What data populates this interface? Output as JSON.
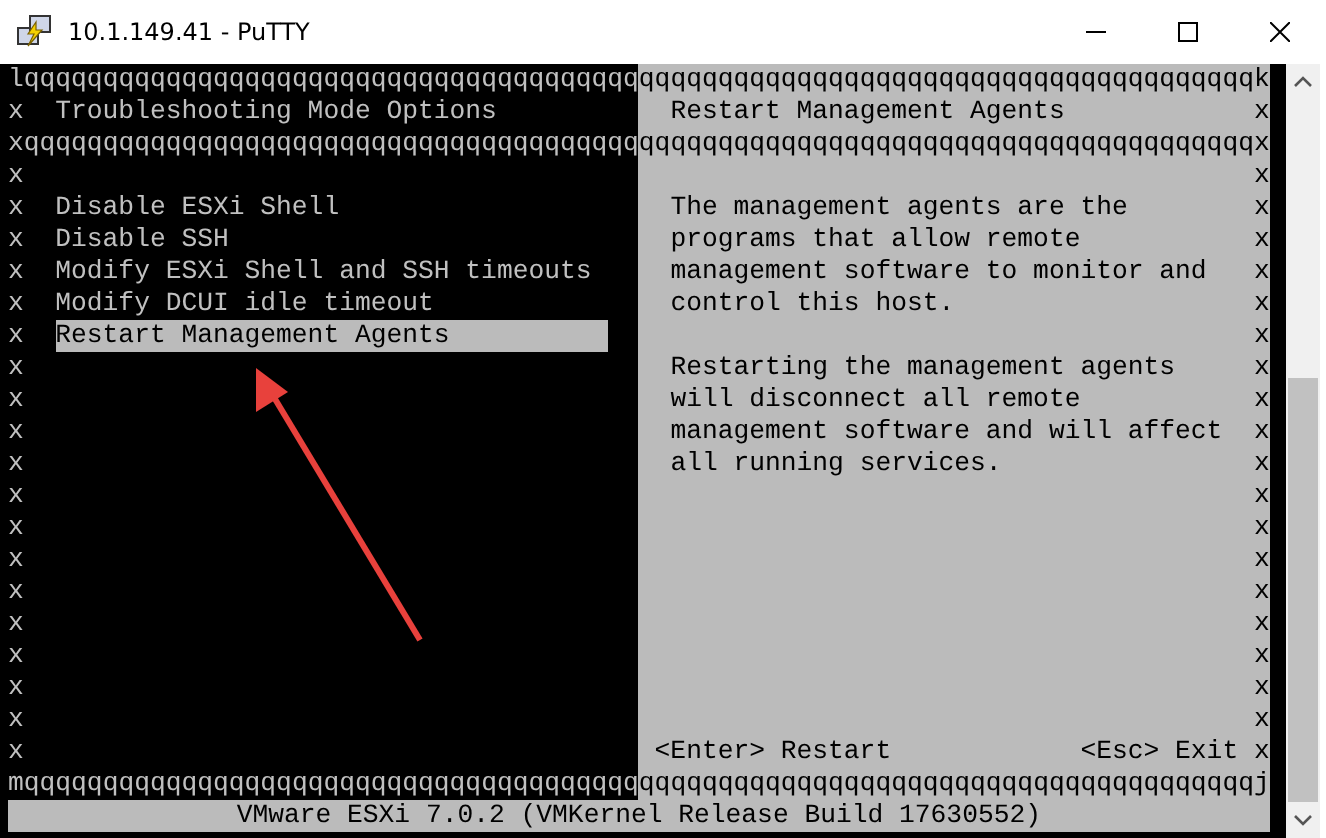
{
  "window": {
    "title": "10.1.149.41 - PuTTY"
  },
  "terminal": {
    "rows": [
      {
        "left": {
          "kind": "border",
          "text": "lqqqqqqqqqqqqqqqqqqqqqqqqqqqqqqqqqqqqqqq"
        },
        "right": {
          "kind": "border",
          "text": "qqqqqqqqqqqqqqqqqqqqqqqqqqqqqqqqqqqqqqqk"
        }
      },
      {
        "left": {
          "kind": "line",
          "edge": "x",
          "text": "Troubleshooting Mode Options"
        },
        "right": {
          "kind": "line",
          "text": "Restart Management Agents",
          "edge": "x"
        }
      },
      {
        "left": {
          "kind": "border",
          "text": "xqqqqqqqqqqqqqqqqqqqqqqqqqqqqqqqqqqqqqqq"
        },
        "right": {
          "kind": "border",
          "text": "qqqqqqqqqqqqqqqqqqqqqqqqqqqqqqqqqqqqqqqx"
        }
      },
      {
        "left": {
          "kind": "line",
          "edge": "x"
        },
        "right": {
          "kind": "line",
          "edge": "x"
        }
      },
      {
        "left": {
          "kind": "item",
          "edge": "x",
          "text": "Disable ESXi Shell",
          "selected": false
        },
        "right": {
          "kind": "line",
          "text": "The management agents are the",
          "edge": "x"
        }
      },
      {
        "left": {
          "kind": "item",
          "edge": "x",
          "text": "Disable SSH",
          "selected": false
        },
        "right": {
          "kind": "line",
          "text": "programs that allow remote",
          "edge": "x"
        }
      },
      {
        "left": {
          "kind": "item",
          "edge": "x",
          "text": "Modify ESXi Shell and SSH timeouts",
          "selected": false
        },
        "right": {
          "kind": "line",
          "text": "management software to monitor and",
          "edge": "x"
        }
      },
      {
        "left": {
          "kind": "item",
          "edge": "x",
          "text": "Modify DCUI idle timeout",
          "selected": false
        },
        "right": {
          "kind": "line",
          "text": "control this host.",
          "edge": "x"
        }
      },
      {
        "left": {
          "kind": "item",
          "edge": "x",
          "text": "Restart Management Agents",
          "selected": true
        },
        "right": {
          "kind": "line",
          "edge": "x"
        }
      },
      {
        "left": {
          "kind": "line",
          "edge": "x"
        },
        "right": {
          "kind": "line",
          "text": "Restarting the management agents",
          "edge": "x"
        }
      },
      {
        "left": {
          "kind": "line",
          "edge": "x"
        },
        "right": {
          "kind": "line",
          "text": "will disconnect all remote",
          "edge": "x"
        }
      },
      {
        "left": {
          "kind": "line",
          "edge": "x"
        },
        "right": {
          "kind": "line",
          "text": "management software and will affect",
          "edge": "x"
        }
      },
      {
        "left": {
          "kind": "line",
          "edge": "x"
        },
        "right": {
          "kind": "line",
          "text": "all running services.",
          "edge": "x"
        }
      },
      {
        "left": {
          "kind": "line",
          "edge": "x"
        },
        "right": {
          "kind": "line",
          "edge": "x"
        }
      },
      {
        "left": {
          "kind": "line",
          "edge": "x"
        },
        "right": {
          "kind": "line",
          "edge": "x"
        }
      },
      {
        "left": {
          "kind": "line",
          "edge": "x"
        },
        "right": {
          "kind": "line",
          "edge": "x"
        }
      },
      {
        "left": {
          "kind": "line",
          "edge": "x"
        },
        "right": {
          "kind": "line",
          "edge": "x"
        }
      },
      {
        "left": {
          "kind": "line",
          "edge": "x"
        },
        "right": {
          "kind": "line",
          "edge": "x"
        }
      },
      {
        "left": {
          "kind": "line",
          "edge": "x"
        },
        "right": {
          "kind": "line",
          "edge": "x"
        }
      },
      {
        "left": {
          "kind": "line",
          "edge": "x"
        },
        "right": {
          "kind": "line",
          "edge": "x"
        }
      },
      {
        "left": {
          "kind": "line",
          "edge": "x"
        },
        "right": {
          "kind": "line",
          "edge": "x"
        }
      },
      {
        "left": {
          "kind": "line",
          "edge": "x"
        },
        "right": {
          "kind": "keys",
          "keys": [
            "<Enter> Restart",
            "<Esc> Exit"
          ],
          "edge": "x"
        }
      },
      {
        "left": {
          "kind": "border",
          "text": "mqqqqqqqqqqqqqqqqqqqqqqqqqqqqqqqqqqqqqqq"
        },
        "right": {
          "kind": "border",
          "text": "qqqqqqqqqqqqqqqqqqqqqqqqqqqqqqqqqqqqqqqj"
        }
      }
    ],
    "status_bar": "VMware ESXi 7.0.2 (VMKernel Release Build 17630552)"
  }
}
